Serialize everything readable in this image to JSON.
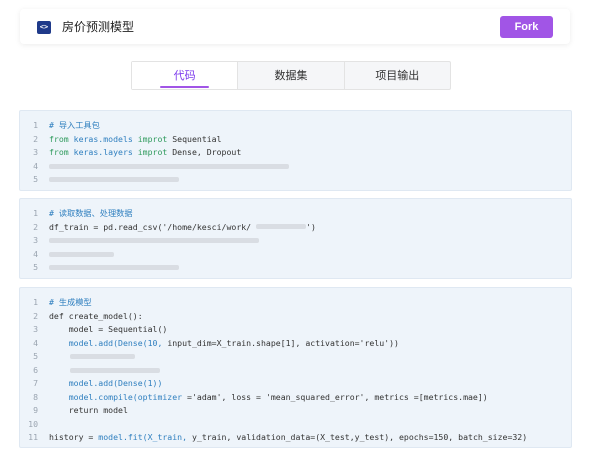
{
  "header": {
    "logo_glyph": "<>",
    "title": "房价预测模型",
    "fork_label": "Fork"
  },
  "tabs": [
    "代码",
    "数据集",
    "项目输出"
  ],
  "blocks": [
    {
      "lines": [
        {
          "n": "1",
          "segs": [
            {
              "t": "# 导入工具包",
              "c": "c"
            }
          ]
        },
        {
          "n": "2",
          "segs": [
            {
              "t": "from",
              "c": "k"
            },
            {
              "t": " keras.models ",
              "c": "m"
            },
            {
              "t": "improt",
              "c": "k"
            },
            {
              "t": " Sequential"
            }
          ]
        },
        {
          "n": "3",
          "segs": [
            {
              "t": "from",
              "c": "k"
            },
            {
              "t": " keras.layers ",
              "c": "m"
            },
            {
              "t": "improt",
              "c": "k"
            },
            {
              "t": " Dense, Dropout"
            }
          ]
        },
        {
          "n": "4",
          "segs": []
        },
        {
          "n": "5",
          "segs": []
        }
      ]
    },
    {
      "lines": [
        {
          "n": "1",
          "segs": [
            {
              "t": "# 读取数据、处理数据",
              "c": "c"
            }
          ]
        },
        {
          "n": "2",
          "segs": [
            {
              "t": "df_train = pd.read_csv('/home/kesci/work/ "
            },
            {
              "ph": true
            },
            {
              "t": "')"
            }
          ]
        },
        {
          "n": "3",
          "segs": []
        },
        {
          "n": "4",
          "segs": []
        },
        {
          "n": "5",
          "segs": []
        }
      ]
    },
    {
      "lines": [
        {
          "n": "1",
          "segs": [
            {
              "t": "# 生成模型",
              "c": "c"
            }
          ]
        },
        {
          "n": "2",
          "segs": [
            {
              "t": "def create_model():"
            }
          ]
        },
        {
          "n": "3",
          "segs": [
            {
              "t": "    model = Sequential()"
            }
          ]
        },
        {
          "n": "4",
          "segs": [
            {
              "t": "    model.add(Dense(10, ",
              "c": "m"
            },
            {
              "t": "input_dim=X_train.shape[1], activation='relu'))"
            }
          ]
        },
        {
          "n": "5",
          "segs": []
        },
        {
          "n": "6",
          "segs": []
        },
        {
          "n": "7",
          "segs": [
            {
              "t": "    model.add(Dense(1))",
              "c": "m"
            }
          ]
        },
        {
          "n": "8",
          "segs": [
            {
              "t": "    model.compile(optimizer ",
              "c": "m"
            },
            {
              "t": "='adam', loss = 'mean_squared_error', metrics =[metrics.mae])"
            }
          ]
        },
        {
          "n": "9",
          "segs": [
            {
              "t": "    return model"
            }
          ]
        },
        {
          "n": "10",
          "segs": []
        },
        {
          "n": "11",
          "segs": [
            {
              "t": "history = "
            },
            {
              "t": "model.fit(X_train, ",
              "c": "m"
            },
            {
              "t": "y_train, validation_data=(X_test,y_test), epochs=150, batch_size=32)"
            }
          ]
        }
      ]
    }
  ]
}
